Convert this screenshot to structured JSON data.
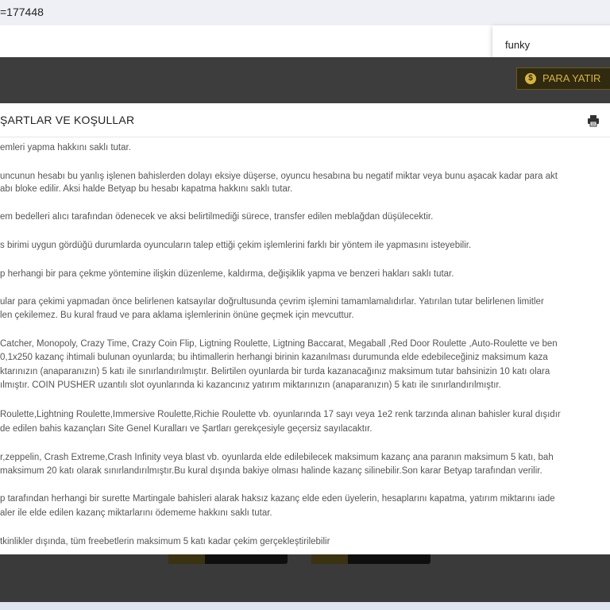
{
  "address_bar": {
    "text": "=177448"
  },
  "search_dropdown": {
    "text": "funky"
  },
  "header": {
    "deposit_label": "PARA YATIR"
  },
  "modal": {
    "title": "ŞARTLAR VE KOŞULLAR",
    "lines": [
      "emleri yapma hakkını saklı tutar.",
      "uncunun hesabı bu yanlış işlenen bahislerden dolayı eksiye düşerse, oyuncu hesabına bu negatif miktar veya bunu aşacak kadar para akt",
      "abı bloke edilir. Aksi halde Betyap bu hesabı kapatma hakkını saklı tutar.",
      "em bedelleri alıcı tarafından ödenecek ve aksi belirtilmediği sürece, transfer edilen meblağdan düşülecektir.",
      "s birimi uygun gördüğü durumlarda oyuncuların talep ettiği çekim işlemlerini farklı bir yöntem ile yapmasını isteyebilir.",
      "p herhangi bir para çekme yöntemine ilişkin düzenleme, kaldırma, değişiklik yapma ve benzeri hakları saklı tutar.",
      "ular para çekimi yapmadan önce belirlenen katsayılar doğrultusunda çevrim işlemini tamamlamalıdırlar. Yatırılan tutar belirlenen limitler",
      "len çekilemez. Bu kural fraud ve para aklama işlemlerinin önüne geçmek için mevcuttur.",
      "Catcher, Monopoly, Crazy Time, Crazy Coin Flip, Ligtning Roulette, Ligtning Baccarat, Megaball ,Red Door Roulette ,Auto-Roulette ve ben",
      "0,1x250 kazanç ihtimali bulunan oyunlarda; bu ihtimallerin herhangi birinin kazanılması durumunda elde edebileceğiniz maksimum kaza",
      "ktarınızın (anaparanızın) 5 katı ile sınırlandırılmıştır. Belirtilen oyunlarda bir turda kazanacağınız maksimum tutar bahsinizin 10 katı olara",
      "ılmıştır. COIN PUSHER uzantılı slot oyunlarında ki kazancınız yatırım miktarınızın (anaparanızın) 5 katı ile sınırlandırılmıştır.",
      "Roulette,Lightning Roulette,Immersive Roulette,Richie Roulette  vb. oyunlarında 17 sayı veya 1e2 renk tarzında alınan bahisler kural dışıdır",
      "de edilen bahis kazançları Site Genel Kuralları ve Şartları gerekçesiyle geçersiz sayılacaktır.",
      "r,zeppelin, Crash Extreme,Crash Infinity veya blast vb. oyunlarda elde edilebilecek maksimum kazanç ana paranın maksimum 5  katı, bah",
      " maksimum 20 katı olarak sınırlandırılmıştır.Bu kural dışında bakiye olması halinde kazanç silinebilir.Son karar Betyap tarafından verilir.",
      "p tarafından herhangi bir surette Martingale bahisleri alarak haksız kazanç elde eden üyelerin, hesaplarını kapatma, yatırım miktarını iade",
      "aler ile elde edilen kazanç miktarlarını ödememe hakkını saklı tutar.",
      "tkinlikler dışında, tüm freebetlerin maksimum 5 katı kadar çekim gerçekleştirilebilir"
    ]
  },
  "colors": {
    "accent_gold": "#d9b43a",
    "dark_background": "#3b3b3b"
  },
  "icons": {
    "print": "print-icon",
    "coin": "dollar-coin-icon"
  }
}
